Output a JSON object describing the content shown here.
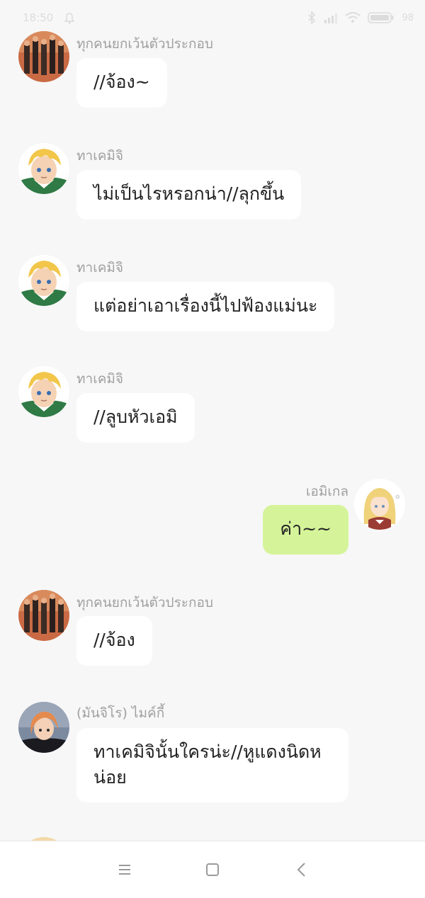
{
  "status_bar": {
    "time": "18:50",
    "battery": "98"
  },
  "messages": [
    {
      "sender": "ทุกคนยกเว้นตัวประกอบ",
      "text": "//จ้อง~",
      "avatar": "group-avatar",
      "side": "left"
    },
    {
      "sender": "ทาเคมิจิ",
      "text": "ไม่เป็นไรหรอกน่า//ลุกขึ้น",
      "avatar": "takemichi-avatar",
      "side": "left"
    },
    {
      "sender": "ทาเคมิจิ",
      "text": "แต่อย่าเอาเรื่องนี้ไปฟ้องแม่นะ",
      "avatar": "takemichi-avatar",
      "side": "left"
    },
    {
      "sender": "ทาเคมิจิ",
      "text": "//ลูบหัวเอมิ",
      "avatar": "takemichi-avatar",
      "side": "left"
    },
    {
      "sender": "เอมิเกล",
      "text": "ค่า~~",
      "avatar": "emi-avatar",
      "side": "right"
    },
    {
      "sender": "ทุกคนยกเว้นตัวประกอบ",
      "text": "//จ้อง",
      "avatar": "group-avatar",
      "side": "left"
    },
    {
      "sender": "(มันจิโร) ไมค์กี้",
      "text": "ทาเคมิจินั้นใครน่ะ//หูแดงนิดหน่อย",
      "avatar": "mikey-avatar",
      "side": "left"
    }
  ],
  "nav": {
    "menu_icon": "menu-icon",
    "home_icon": "home-square-icon",
    "back_icon": "back-chevron-icon"
  },
  "colors": {
    "background": "#f7f7f7",
    "bubble_other": "#ffffff",
    "bubble_me": "#d5f49a",
    "sender_text": "#a0a0a0"
  }
}
